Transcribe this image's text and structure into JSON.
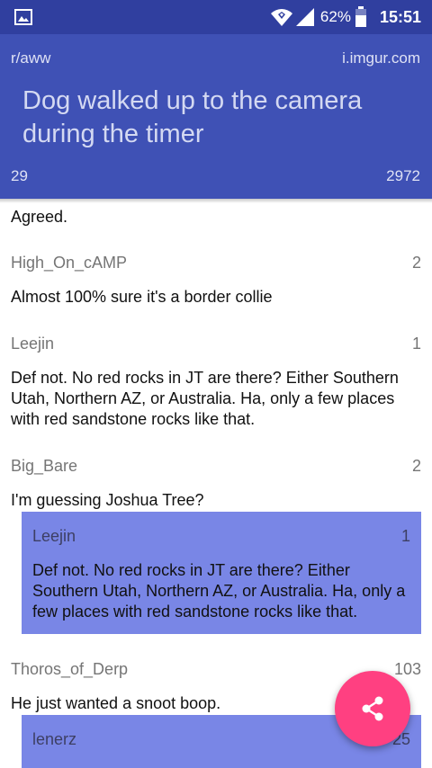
{
  "status_bar": {
    "battery_percent": "62%",
    "time": "15:51",
    "icons": [
      "image-notification-icon",
      "wifi-icon",
      "cell-signal-icon",
      "battery-icon"
    ]
  },
  "post": {
    "subreddit": "r/aww",
    "domain": "i.imgur.com",
    "title": "Dog walked up to the camera during the timer",
    "score": "29",
    "comment_count": "2972"
  },
  "comments": [
    {
      "body": "Agreed."
    },
    {
      "author": "High_On_cAMP",
      "points": "2",
      "body": "Almost 100% sure it's a border collie"
    },
    {
      "author": "Leejin",
      "points": "1",
      "body": "Def not. No red rocks in JT are there? Either Southern Utah, Northern AZ, or Australia. Ha, only a few places with red sandstone rocks like that."
    },
    {
      "author": "Big_Bare",
      "points": "2",
      "body": "I'm guessing Joshua Tree?",
      "reply": {
        "author": "Leejin",
        "points": "1",
        "body": "Def not. No red rocks in JT are there? Either Southern Utah, Northern AZ, or Australia. Ha, only a few places with red sandstone rocks like that."
      }
    },
    {
      "author": "Thoros_of_Derp",
      "points": "103",
      "body": "He just wanted a snoot boop.",
      "reply": {
        "author": "lenerz",
        "points": "25"
      }
    }
  ],
  "colors": {
    "status_bar": "#303f9f",
    "header": "#3f51b5",
    "nested_comment": "#7986e6",
    "fab": "#ff4081"
  },
  "fab": {
    "icon": "share-icon"
  }
}
